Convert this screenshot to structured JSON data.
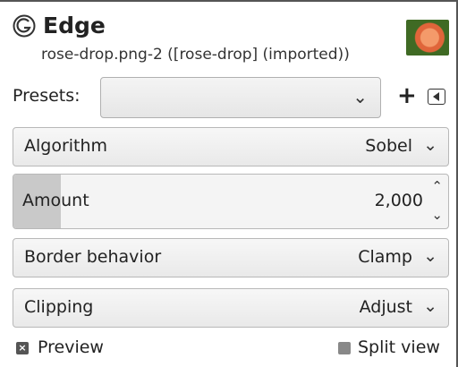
{
  "header": {
    "title": "Edge",
    "subtitle": "rose-drop.png-2 ([rose-drop] (imported))",
    "icon": "gimp-icon",
    "thumbnail": "rose-thumbnail"
  },
  "presets": {
    "label": "Presets:",
    "value": "",
    "add_label": "+",
    "menu_icon": "menu-arrow-icon"
  },
  "algorithm": {
    "label": "Algorithm",
    "value": "Sobel"
  },
  "amount": {
    "label": "Amount",
    "value": "2,000",
    "fill_fraction": 0.11
  },
  "border_behavior": {
    "label": "Border behavior",
    "value": "Clamp"
  },
  "clipping": {
    "label": "Clipping",
    "value": "Adjust"
  },
  "preview": {
    "label": "Preview",
    "checked": true
  },
  "split_view": {
    "label": "Split view",
    "checked": false
  }
}
